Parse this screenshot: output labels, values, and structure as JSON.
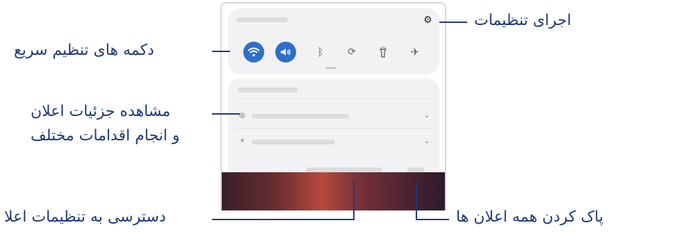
{
  "callouts": {
    "settings": "اجرای تنظیمات",
    "quick_buttons": "دکمه های تنظیم سریع",
    "details_line1": "مشاهده جزئیات اعلان",
    "details_line2": "و انجام اقدامات مختلف",
    "notif_settings": "دسترسی به تنظیمات اعلا",
    "clear_all": "پاک کردن همه اعلان ها"
  },
  "icons": {
    "settings": "gear-icon",
    "quick": [
      "wifi-icon",
      "sound-icon",
      "bluetooth-icon",
      "auto-rotate-icon",
      "flashlight-icon",
      "airplane-icon"
    ],
    "notif_rows": [
      "notification-app-icon",
      "charging-icon"
    ]
  },
  "quick_state": [
    true,
    true,
    false,
    false,
    false,
    false
  ],
  "colors": {
    "accent": "#1e3a7a",
    "toggle_on": "#2f6fca"
  }
}
